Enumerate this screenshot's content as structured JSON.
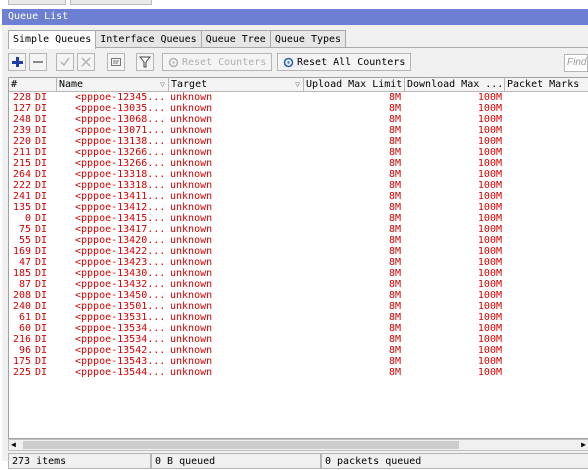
{
  "window": {
    "title": "Queue List"
  },
  "tabs": [
    {
      "label": "Simple Queues",
      "active": true
    },
    {
      "label": "Interface Queues",
      "active": false
    },
    {
      "label": "Queue Tree",
      "active": false
    },
    {
      "label": "Queue Types",
      "active": false
    }
  ],
  "toolbar": {
    "add_icon": "plus-icon",
    "remove_icon": "minus-icon",
    "enable_icon": "check-icon",
    "disable_icon": "cross-icon",
    "comment_icon": "comment-icon",
    "filter_icon": "filter-icon",
    "reset_counters_label": "Reset Counters",
    "reset_all_counters_label": "Reset All Counters",
    "find_placeholder": "Find"
  },
  "columns": [
    "#",
    "Name",
    "Target",
    "Upload Max Limit",
    "Download Max ...",
    "Packet Marks"
  ],
  "rows": [
    {
      "id": "228",
      "flags": "DI",
      "name": "<pppoe-12345...",
      "target": "unknown",
      "upload": "8M",
      "download": "100M"
    },
    {
      "id": "127",
      "flags": "DI",
      "name": "<pppoe-13035...",
      "target": "unknown",
      "upload": "8M",
      "download": "100M"
    },
    {
      "id": "248",
      "flags": "DI",
      "name": "<pppoe-13068...",
      "target": "unknown",
      "upload": "8M",
      "download": "100M"
    },
    {
      "id": "239",
      "flags": "DI",
      "name": "<pppoe-13071...",
      "target": "unknown",
      "upload": "8M",
      "download": "100M"
    },
    {
      "id": "220",
      "flags": "DI",
      "name": "<pppoe-13138...",
      "target": "unknown",
      "upload": "8M",
      "download": "100M"
    },
    {
      "id": "211",
      "flags": "DI",
      "name": "<pppoe-13266...",
      "target": "unknown",
      "upload": "8M",
      "download": "100M"
    },
    {
      "id": "215",
      "flags": "DI",
      "name": "<pppoe-13266...",
      "target": "unknown",
      "upload": "8M",
      "download": "100M"
    },
    {
      "id": "264",
      "flags": "DI",
      "name": "<pppoe-13318...",
      "target": "unknown",
      "upload": "8M",
      "download": "100M"
    },
    {
      "id": "222",
      "flags": "DI",
      "name": "<pppoe-13318...",
      "target": "unknown",
      "upload": "8M",
      "download": "100M"
    },
    {
      "id": "241",
      "flags": "DI",
      "name": "<pppoe-13411...",
      "target": "unknown",
      "upload": "8M",
      "download": "100M"
    },
    {
      "id": "135",
      "flags": "DI",
      "name": "<pppoe-13412...",
      "target": "unknown",
      "upload": "8M",
      "download": "100M"
    },
    {
      "id": "0",
      "flags": "DI",
      "name": "<pppoe-13415...",
      "target": "unknown",
      "upload": "8M",
      "download": "100M"
    },
    {
      "id": "75",
      "flags": "DI",
      "name": "<pppoe-13417...",
      "target": "unknown",
      "upload": "8M",
      "download": "100M"
    },
    {
      "id": "55",
      "flags": "DI",
      "name": "<pppoe-13420...",
      "target": "unknown",
      "upload": "8M",
      "download": "100M"
    },
    {
      "id": "169",
      "flags": "DI",
      "name": "<pppoe-13422...",
      "target": "unknown",
      "upload": "8M",
      "download": "100M"
    },
    {
      "id": "47",
      "flags": "DI",
      "name": "<pppoe-13423...",
      "target": "unknown",
      "upload": "8M",
      "download": "100M"
    },
    {
      "id": "185",
      "flags": "DI",
      "name": "<pppoe-13430...",
      "target": "unknown",
      "upload": "8M",
      "download": "100M"
    },
    {
      "id": "87",
      "flags": "DI",
      "name": "<pppoe-13432...",
      "target": "unknown",
      "upload": "8M",
      "download": "100M"
    },
    {
      "id": "208",
      "flags": "DI",
      "name": "<pppoe-13450...",
      "target": "unknown",
      "upload": "8M",
      "download": "100M"
    },
    {
      "id": "240",
      "flags": "DI",
      "name": "<pppoe-13501...",
      "target": "unknown",
      "upload": "8M",
      "download": "100M"
    },
    {
      "id": "61",
      "flags": "DI",
      "name": "<pppoe-13531...",
      "target": "unknown",
      "upload": "8M",
      "download": "100M"
    },
    {
      "id": "60",
      "flags": "DI",
      "name": "<pppoe-13534...",
      "target": "unknown",
      "upload": "8M",
      "download": "100M"
    },
    {
      "id": "216",
      "flags": "DI",
      "name": "<pppoe-13534...",
      "target": "unknown",
      "upload": "8M",
      "download": "100M"
    },
    {
      "id": "96",
      "flags": "DI",
      "name": "<pppoe-13542...",
      "target": "unknown",
      "upload": "8M",
      "download": "100M"
    },
    {
      "id": "175",
      "flags": "DI",
      "name": "<pppoe-13543...",
      "target": "unknown",
      "upload": "8M",
      "download": "100M"
    },
    {
      "id": "225",
      "flags": "DI",
      "name": "<pppoe-13544...",
      "target": "unknown",
      "upload": "8M",
      "download": "100M"
    }
  ],
  "status": {
    "items": "273 items",
    "bytes_queued": "0 B queued",
    "packets_queued": "0 packets queued"
  },
  "colors": {
    "title_bar": "#6d7fd3",
    "row_text": "#d40000",
    "queue_icon": "#1ea81e"
  }
}
